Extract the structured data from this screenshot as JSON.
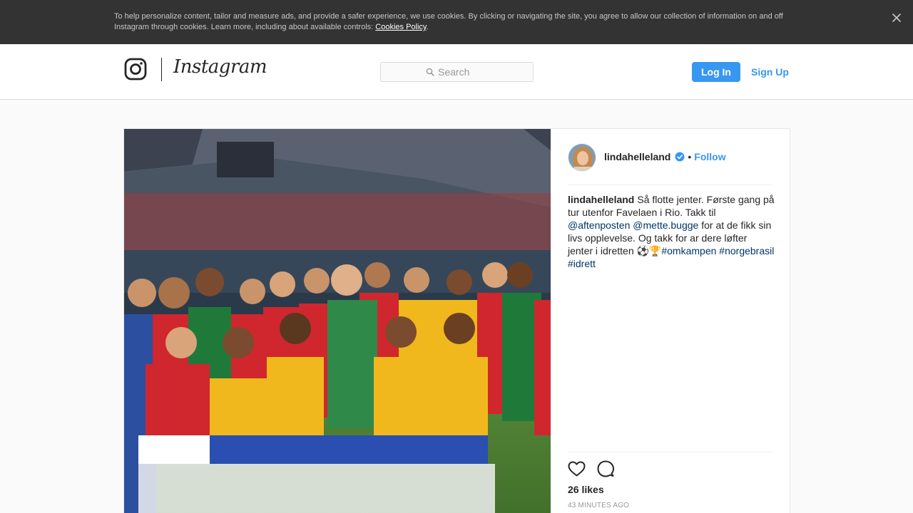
{
  "cookie_banner": {
    "text": "To help personalize content, tailor and measure ads, and provide a safer experience, we use cookies. By clicking or navigating the site, you agree to allow our collection of information on and off Instagram through cookies. Learn more, including about available controls: ",
    "link_text": "Cookies Policy",
    "suffix": ".",
    "close_icon": "close-icon"
  },
  "header": {
    "logo_icon": "instagram-glyph-icon",
    "wordmark": "Instagram",
    "search": {
      "placeholder": "Search",
      "icon": "search-icon"
    },
    "login_label": "Log In",
    "signup_label": "Sign Up"
  },
  "post": {
    "image_description_icon": "post-photo",
    "author": {
      "username": "lindahelleland",
      "verified": true,
      "separator": "•",
      "follow_label": "Follow"
    },
    "caption": {
      "username": "lindahelleland",
      "text_1": "Så flotte jenter. Første gang på tur utenfor Favelaen i Rio. Takk til ",
      "mention_1": "@aftenposten",
      "space": " ",
      "mention_2": "@mette.bugge",
      "text_2": " for at de fikk sin livs opplevelse. Og takk for ar dere løfter jenter i idretten ⚽🏆",
      "hashtag_1": "#omkampen",
      "hashtag_2": "#norgebrasil",
      "hashtag_3": "#idrett"
    },
    "likes": "26 likes",
    "timestamp": "43 minutes ago"
  },
  "colors": {
    "accent": "#3897f0",
    "hashtag": "#003569",
    "cookie_bg": "#333333"
  }
}
